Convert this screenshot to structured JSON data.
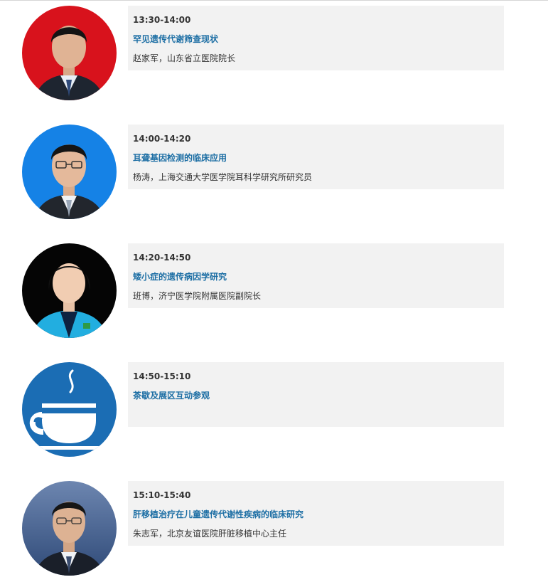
{
  "sessions": [
    {
      "time": "13:30-14:00",
      "title": "罕见遗传代谢筛查现状",
      "speaker": "赵家军，山东省立医院院长",
      "avatar_bg": "#d8121c"
    },
    {
      "time": "14:00-14:20",
      "title": "耳聋基因检测的临床应用",
      "speaker": "杨涛，上海交通大学医学院耳科学研究所研究员",
      "avatar_bg": "#1582e6"
    },
    {
      "time": "14:20-14:50",
      "title": "矮小症的遗传病因学研究",
      "speaker": "班博，济宁医学院附属医院副院长",
      "avatar_bg": "#050505"
    },
    {
      "time": "14:50-15:10",
      "title": "茶歇及展区互动参观",
      "speaker": "",
      "avatar_bg": "#1b6db4"
    },
    {
      "time": "15:10-15:40",
      "title": "肝移植治疗在儿童遗传代谢性疾病的临床研究",
      "speaker": "朱志军，北京友谊医院肝脏移植中心主任",
      "avatar_bg": "#4a6a9a"
    }
  ],
  "colors": {
    "title": "#1c6ea4",
    "card_bg": "#f2f2f2",
    "text": "#333333"
  }
}
